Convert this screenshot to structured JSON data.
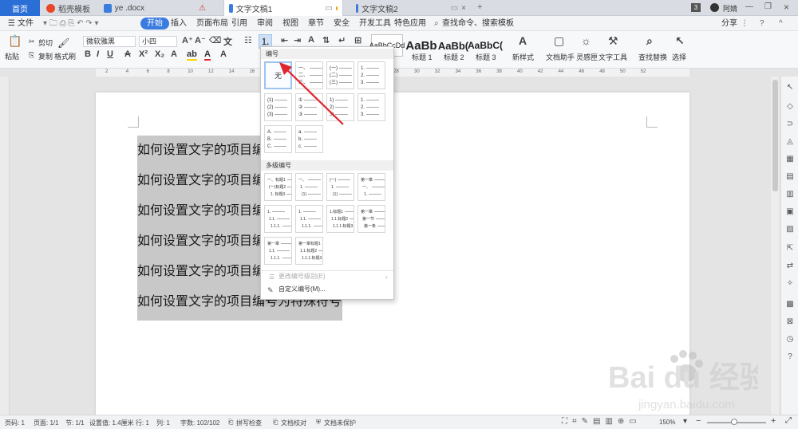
{
  "tabs": [
    {
      "label": "首页"
    },
    {
      "label": "稻壳模板"
    },
    {
      "label": "ye .docx"
    },
    {
      "label": "文字文稿1"
    },
    {
      "label": "文字文稿2"
    }
  ],
  "titlebar": {
    "page_count": "3",
    "user": "阿婧"
  },
  "menu": {
    "file": "文件",
    "items": [
      "开始",
      "插入",
      "页面布局",
      "引用",
      "审阅",
      "视图",
      "章节",
      "安全",
      "开发工具",
      "特色应用"
    ],
    "search": "查找命令、搜索模板",
    "share": "分享"
  },
  "ribbon": {
    "paste": "粘贴",
    "cut": "剪切",
    "copy": "复制",
    "format_painter": "格式刷",
    "font_name": "微软雅黑",
    "font_size": "小四",
    "styles": [
      {
        "preview": "AaBbCcDd",
        "name": ""
      },
      {
        "preview": "AaBb",
        "name": "标题 1"
      },
      {
        "preview": "AaBb(",
        "name": "标题 2"
      },
      {
        "preview": "AaBbC(",
        "name": "标题 3"
      }
    ],
    "new_style": "新样式",
    "doc_helper": "文档助手",
    "inspiration": "灵感匣",
    "text_tools": "文字工具",
    "find_replace": "查找替换",
    "select": "选择"
  },
  "ruler": {
    "numbers": [
      "2",
      "4",
      "6",
      "8",
      "10",
      "12",
      "14",
      "16",
      "18",
      "20",
      "22",
      "24",
      "25",
      "26",
      "28",
      "30",
      "32",
      "34",
      "36",
      "38",
      "40",
      "42",
      "44",
      "46",
      "48",
      "50",
      "52"
    ]
  },
  "document": {
    "lines": [
      "如何设置文字的项目编号",
      "如何设置文字的项目编号",
      "如何设置文字的项目编号",
      "如何设置文字的项目编号",
      "如何设置文字的项目编号",
      "如何设置文字的项目编号为特殊符号"
    ]
  },
  "dropdown": {
    "section_numbering": "编号",
    "section_multilevel": "多级编号",
    "none_label": "无",
    "cells": [
      [
        "一、",
        "二、",
        "三、"
      ],
      [
        "(一)",
        "(二)",
        "(三)"
      ],
      [
        "1.",
        "2.",
        "3."
      ],
      [
        "(1)",
        "(2)",
        "(3)"
      ],
      [
        "①",
        "②",
        "③"
      ],
      [
        "1)",
        "2)",
        "3)"
      ],
      [
        "1.",
        "2.",
        "3."
      ],
      [
        "A.",
        "B.",
        "C."
      ],
      [
        "a.",
        "b.",
        "c."
      ]
    ],
    "multi_cells": [
      [
        "一、标题1",
        "(一)标题2",
        "1. 标题3"
      ],
      [
        "一、",
        "1.",
        "(1)"
      ],
      [
        "(一)",
        "1.",
        "(1)"
      ],
      [
        "第一章",
        "一、",
        "1."
      ],
      [
        "1.",
        "1.1.",
        "1.1.1."
      ],
      [
        "1.",
        "1.1.",
        "1.1.1."
      ],
      [
        "1.标题1",
        "1.1.标题2",
        "1.1.1.标题3"
      ],
      [
        "第一章",
        "第一节",
        "第一条"
      ],
      [
        "第一章",
        "1.1.",
        "1.1.1."
      ],
      [
        "第一章标题1",
        "1.1.标题2",
        "1.1.1.标题3"
      ]
    ],
    "change_level": "更改编号级别(E)",
    "custom": "自定义编号(M)..."
  },
  "statusbar": {
    "page_num": "页码: 1",
    "pages": "页面: 1/1",
    "section": "节: 1/1",
    "setting": "设置值: 1.4厘米",
    "row": "行: 1",
    "col": "列: 1",
    "words": "字数: 102/102",
    "spell": "拼写检查",
    "proofread": "文档校对",
    "protect": "文档未保护",
    "zoom": "150%"
  },
  "watermark": {
    "brand": "Bai du 经验",
    "url": "jingyan.baidu.com"
  },
  "colors": {
    "accent": "#3a7be0",
    "arrow": "#e0262e",
    "selection": "#c8c8c8"
  }
}
